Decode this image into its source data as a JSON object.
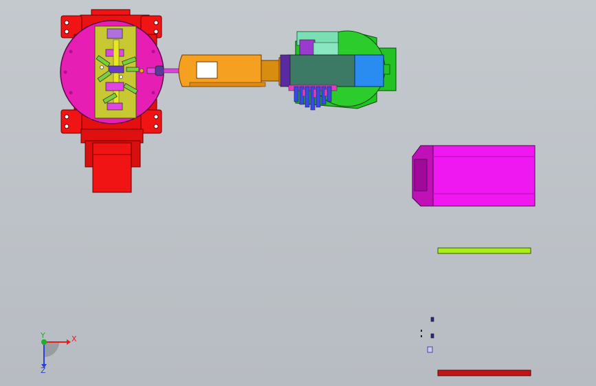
{
  "view": {
    "background": "#bcc1c6"
  },
  "triad": {
    "x_label": "X",
    "y_label": "Y",
    "z_label": "Z",
    "x_color": "#e0201c",
    "y_color": "#1fae2e",
    "z_color": "#2c3fd6"
  },
  "parts": {
    "base_color": "#f01414",
    "turntable_color": "#e61eb4",
    "fixture_color": "#c8c832",
    "arm_color": "#f5a020",
    "motor_green": "#22c322",
    "motor_teal": "#3c7a66",
    "motor_blue": "#2a8cf0",
    "block_color": "#f018f0",
    "bar_green_color": "#a6f018",
    "bar_red_color": "#c41414"
  }
}
